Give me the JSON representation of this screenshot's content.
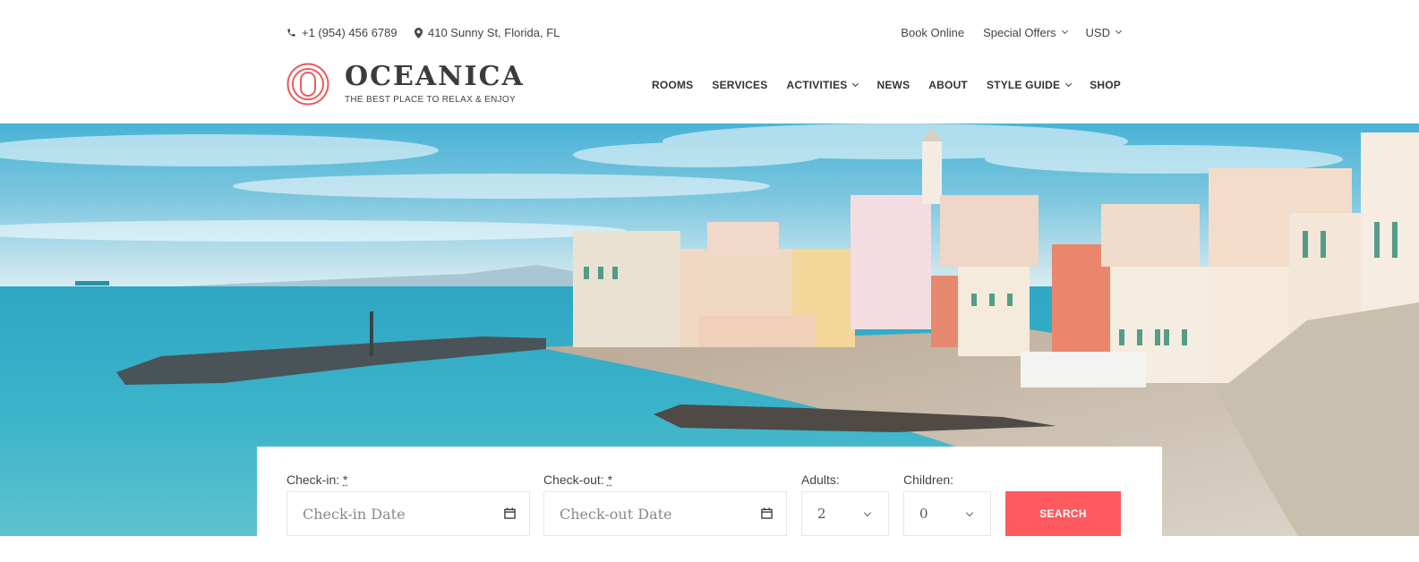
{
  "topbar": {
    "phone": "+1 (954) 456 6789",
    "address": "410 Sunny St, Florida, FL",
    "links": [
      {
        "label": "Book Online",
        "dropdown": false
      },
      {
        "label": "Special Offers",
        "dropdown": true
      },
      {
        "label": "USD",
        "dropdown": true
      }
    ]
  },
  "header": {
    "brand": "OCEANICA",
    "tagline": "THE BEST PLACE TO RELAX & ENJOY",
    "nav": [
      {
        "label": "ROOMS",
        "dropdown": false
      },
      {
        "label": "SERVICES",
        "dropdown": false
      },
      {
        "label": "ACTIVITIES",
        "dropdown": true
      },
      {
        "label": "NEWS",
        "dropdown": false
      },
      {
        "label": "ABOUT",
        "dropdown": false
      },
      {
        "label": "STYLE GUIDE",
        "dropdown": true
      },
      {
        "label": "SHOP",
        "dropdown": false
      }
    ]
  },
  "hero": {
    "description": "Coastal Italian village with colorful buildings, pier and turquoise sea"
  },
  "booking": {
    "checkin": {
      "label": "Check-in:",
      "required_mark": "*",
      "placeholder": "Check-in Date"
    },
    "checkout": {
      "label": "Check-out:",
      "required_mark": "*",
      "placeholder": "Check-out Date"
    },
    "adults": {
      "label": "Adults:",
      "value": "2"
    },
    "children": {
      "label": "Children:",
      "value": "0"
    },
    "search_label": "SEARCH"
  },
  "colors": {
    "accent": "#ff5a5f",
    "logo": "#ee5a5e",
    "text": "#3b3b3b"
  }
}
